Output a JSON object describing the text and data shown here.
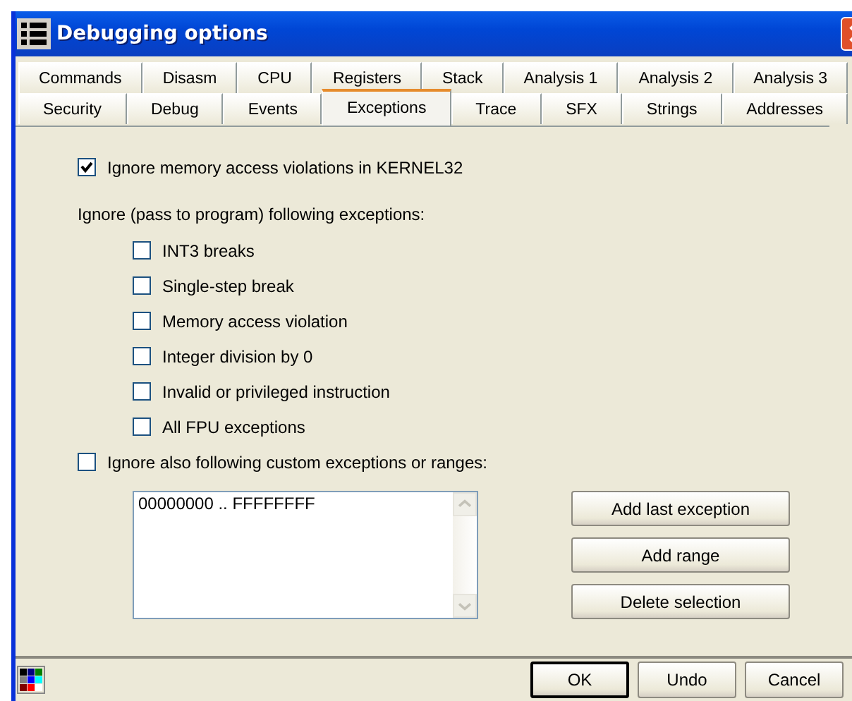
{
  "window": {
    "title": "Debugging options"
  },
  "tab_rows": [
    [
      {
        "label": "Commands",
        "selected": false
      },
      {
        "label": "Disasm",
        "selected": false
      },
      {
        "label": "CPU",
        "selected": false
      },
      {
        "label": "Registers",
        "selected": false
      },
      {
        "label": "Stack",
        "selected": false
      },
      {
        "label": "Analysis 1",
        "selected": false
      },
      {
        "label": "Analysis 2",
        "selected": false
      },
      {
        "label": "Analysis 3",
        "selected": false
      }
    ],
    [
      {
        "label": "Security",
        "selected": false
      },
      {
        "label": "Debug",
        "selected": false
      },
      {
        "label": "Events",
        "selected": false
      },
      {
        "label": "Exceptions",
        "selected": true
      },
      {
        "label": "Trace",
        "selected": false
      },
      {
        "label": "SFX",
        "selected": false
      },
      {
        "label": "Strings",
        "selected": false
      },
      {
        "label": "Addresses",
        "selected": false
      }
    ]
  ],
  "kernel32_option": {
    "label": "Ignore memory access violations in KERNEL32",
    "checked": true
  },
  "exceptions_label": "Ignore (pass to program) following exceptions:",
  "exceptions": [
    {
      "label": "INT3 breaks",
      "checked": false
    },
    {
      "label": "Single-step break",
      "checked": false
    },
    {
      "label": "Memory access violation",
      "checked": false
    },
    {
      "label": "Integer division by 0",
      "checked": false
    },
    {
      "label": "Invalid or privileged instruction",
      "checked": false
    },
    {
      "label": "All FPU exceptions",
      "checked": false
    }
  ],
  "custom_option": {
    "label": "Ignore also following custom exceptions or ranges:",
    "checked": false
  },
  "custom_ranges": [
    "00000000 .. FFFFFFFF"
  ],
  "range_buttons": [
    "Add last exception",
    "Add range",
    "Delete selection"
  ],
  "footer_buttons": [
    {
      "label": "OK",
      "default": true
    },
    {
      "label": "Undo",
      "default": false
    },
    {
      "label": "Cancel",
      "default": false
    }
  ]
}
